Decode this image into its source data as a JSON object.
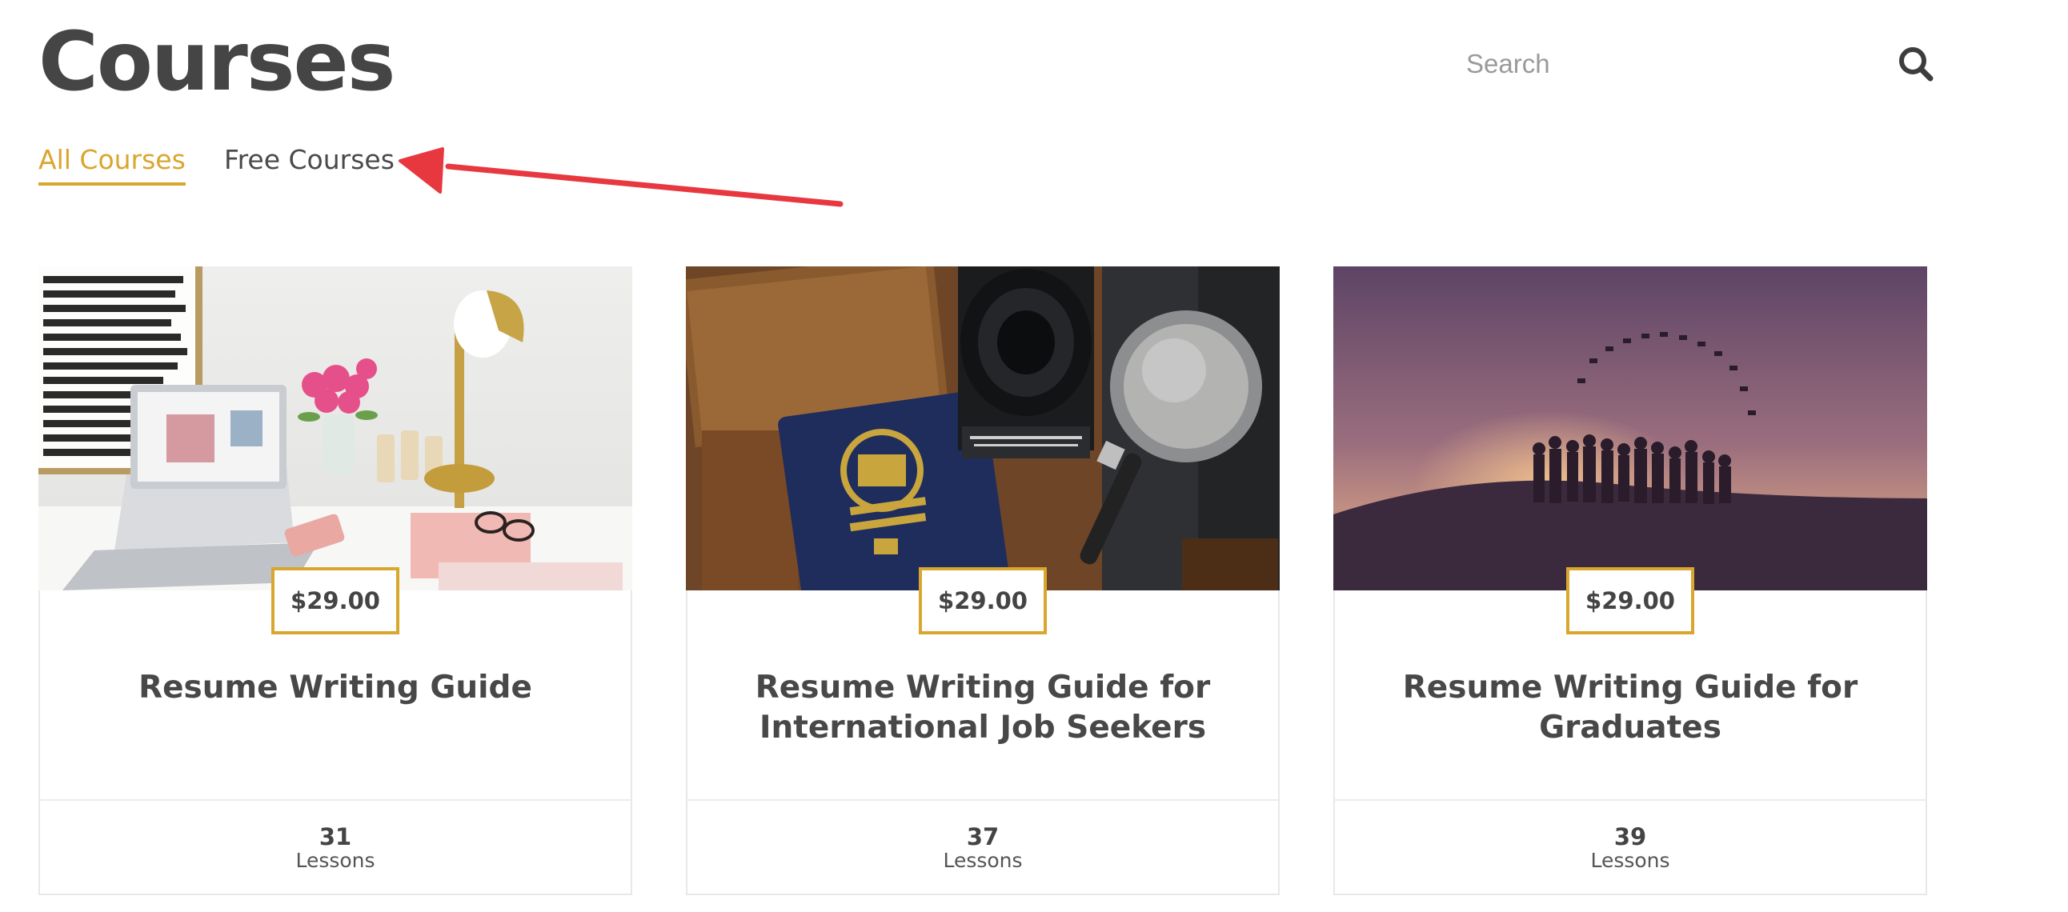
{
  "header": {
    "title": "Courses",
    "search": {
      "placeholder": "Search",
      "value": ""
    }
  },
  "tabs": [
    {
      "label": "All Courses",
      "active": true
    },
    {
      "label": "Free Courses",
      "active": false
    }
  ],
  "annotation": {
    "arrow_color": "#e8383f",
    "points_to": "Free Courses"
  },
  "colors": {
    "accent": "#d9a62e",
    "text": "#444444",
    "border": "#e8e8e8"
  },
  "courses": [
    {
      "image": "desk-laptop-flowers-lamp-photo",
      "price": "$29.00",
      "title": "Resume Writing Guide",
      "lessons_count": "31",
      "lessons_label": "Lessons"
    },
    {
      "image": "passport-camera-lens-wallet-photo",
      "price": "$29.00",
      "title": "Resume Writing Guide for International Job Seekers",
      "lessons_count": "37",
      "lessons_label": "Lessons"
    },
    {
      "image": "graduates-throwing-caps-sunset-photo",
      "price": "$29.00",
      "title": "Resume Writing Guide for Graduates",
      "lessons_count": "39",
      "lessons_label": "Lessons"
    }
  ]
}
